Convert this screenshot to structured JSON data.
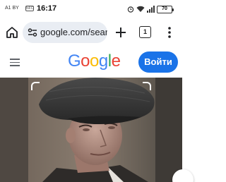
{
  "status_bar": {
    "carrier": "A1 BY",
    "nfc_badge": "NFC",
    "time": "16:17",
    "battery": "70",
    "icons": [
      "alarm-icon",
      "wifi-icon",
      "signal-icon",
      "battery-icon"
    ]
  },
  "browser": {
    "url": "google.com/sear",
    "tab_count": "1",
    "icons": [
      "home-icon",
      "site-settings-icon",
      "new-tab-plus-icon",
      "tab-switcher-icon",
      "more-vert-icon"
    ]
  },
  "google_header": {
    "logo_letters": [
      "G",
      "o",
      "o",
      "g",
      "l",
      "e"
    ],
    "signin_label": "Войти",
    "colors": {
      "blue": "#4285f4",
      "red": "#ea4335",
      "yellow": "#fbbc05",
      "green": "#34a853",
      "button": "#1a73e8"
    }
  },
  "image": {
    "subject": "man-in-flat-cap-photo",
    "selection_corners": true
  }
}
